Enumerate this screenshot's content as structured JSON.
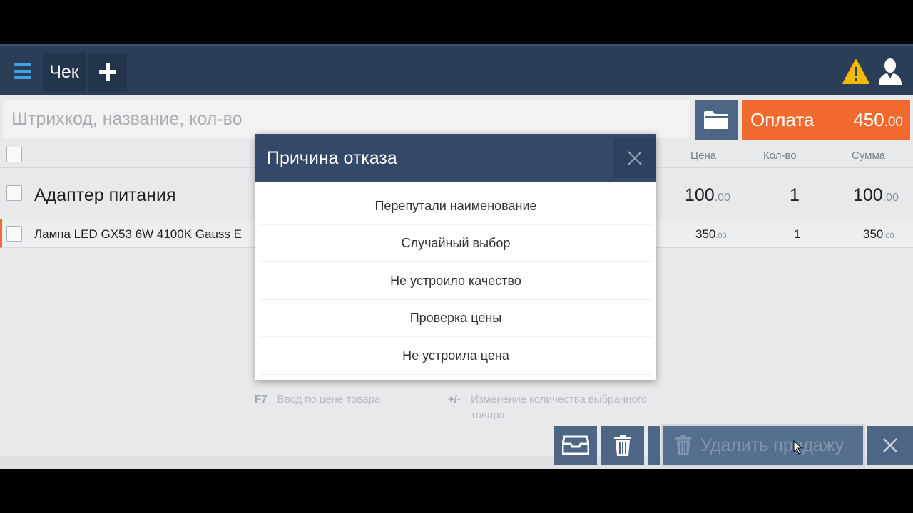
{
  "topbar": {
    "tab_label": "Чек",
    "add_label": "+"
  },
  "search": {
    "placeholder": "Штрихкод, название, кол-во"
  },
  "payment": {
    "label": "Оплата",
    "amount_main": "450",
    "amount_cents": ".00"
  },
  "table": {
    "headers": {
      "price": "Цена",
      "qty": "Кол-во",
      "sum": "Сумма"
    },
    "rows": [
      {
        "name": "Адаптер питания",
        "price_main": "100",
        "price_cents": ".00",
        "qty": "1",
        "sum_main": "100",
        "sum_cents": ".00"
      },
      {
        "name": "Лампа LED GX53 6W 4100K Gauss E",
        "price_main": "350",
        "price_cents": ".00",
        "qty": "1",
        "sum_main": "350",
        "sum_cents": ".00"
      }
    ]
  },
  "hints": {
    "f7_key": "F7",
    "f7_text": "Ввод по цене товара",
    "qty_key": "+/-",
    "qty_text_line1": "Изменение количества выбранного",
    "qty_text_line2": "товара"
  },
  "bottom": {
    "delete_label": "Удалить продажу"
  },
  "modal": {
    "title": "Причина отказа",
    "reasons": [
      "Перепутали наименование",
      "Случайный выбор",
      "Не устроило качество",
      "Проверка цены",
      "Не устроила цена"
    ]
  },
  "colors": {
    "topbar": "#2b3e58",
    "accent_orange": "#f26a2d",
    "button_blue": "#4d6686",
    "menu_blue": "#3aa3ea",
    "warning_yellow": "#f5b800"
  }
}
